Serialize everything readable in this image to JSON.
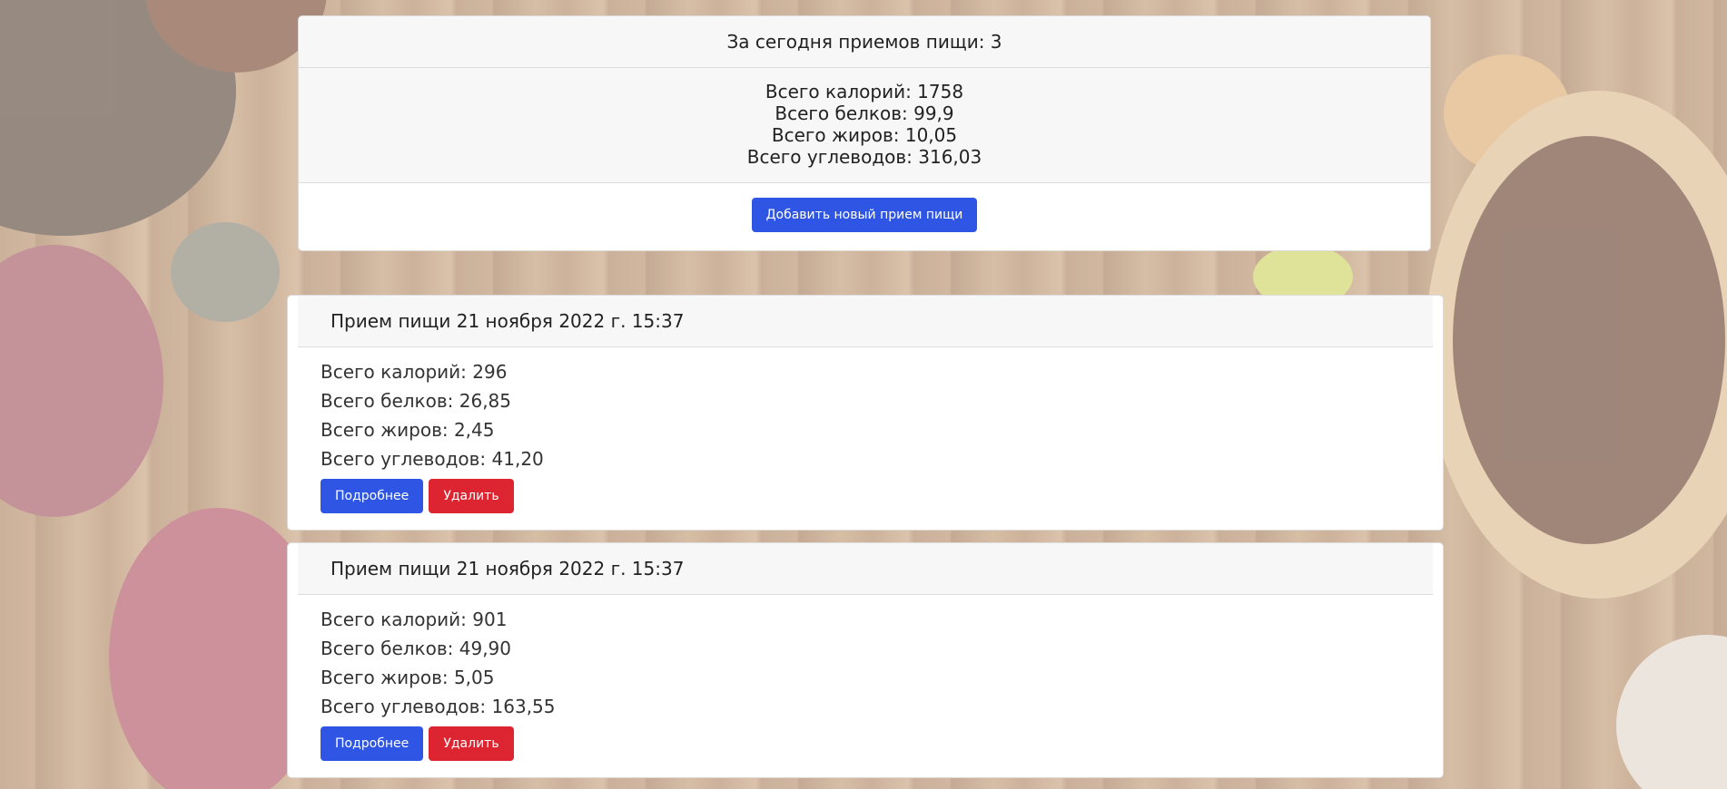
{
  "summary": {
    "meals_today": "За сегодня приемов пищи: 3",
    "totals": {
      "calories": "Всего калорий: 1758",
      "proteins": "Всего белков: 99,9",
      "fats": "Всего жиров: 10,05",
      "carbs": "Всего углеводов: 316,03"
    },
    "add_button": "Добавить новый прием пищи"
  },
  "meals": [
    {
      "title": "Прием пищи 21 ноября 2022 г. 15:37",
      "calories": "Всего калорий: 296",
      "proteins": "Всего белков: 26,85",
      "fats": "Всего жиров: 2,45",
      "carbs": "Всего углеводов: 41,20",
      "details_button": "Подробнее",
      "delete_button": "Удалить"
    },
    {
      "title": "Прием пищи 21 ноября 2022 г. 15:37",
      "calories": "Всего калорий: 901",
      "proteins": "Всего белков: 49,90",
      "fats": "Всего жиров: 5,05",
      "carbs": "Всего углеводов: 163,55",
      "details_button": "Подробнее",
      "delete_button": "Удалить"
    }
  ],
  "colors": {
    "primary": "#2f55e4",
    "danger": "#dc2530"
  }
}
